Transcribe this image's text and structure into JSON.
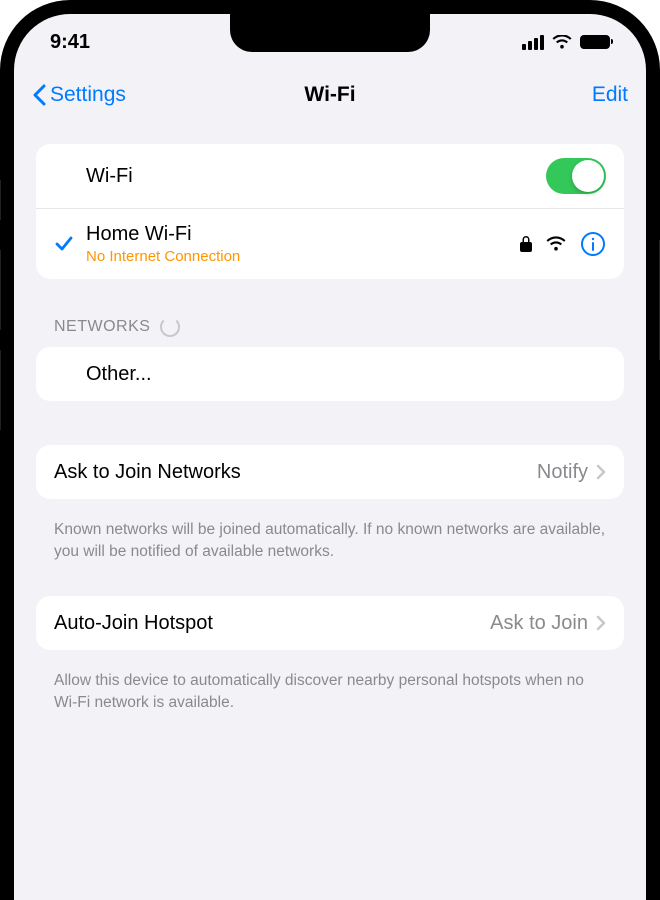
{
  "status": {
    "time": "9:41"
  },
  "nav": {
    "back": "Settings",
    "title": "Wi-Fi",
    "edit": "Edit"
  },
  "wifi_toggle": {
    "label": "Wi-Fi",
    "on": true
  },
  "connected": {
    "name": "Home Wi-Fi",
    "status": "No Internet Connection"
  },
  "networks": {
    "header": "NETWORKS",
    "other": "Other..."
  },
  "ask_join": {
    "label": "Ask to Join Networks",
    "value": "Notify",
    "footer": "Known networks will be joined automatically. If no known networks are available, you will be notified of available networks."
  },
  "auto_hotspot": {
    "label": "Auto-Join Hotspot",
    "value": "Ask to Join",
    "footer": "Allow this device to automatically discover nearby personal hotspots when no Wi-Fi network is available."
  }
}
